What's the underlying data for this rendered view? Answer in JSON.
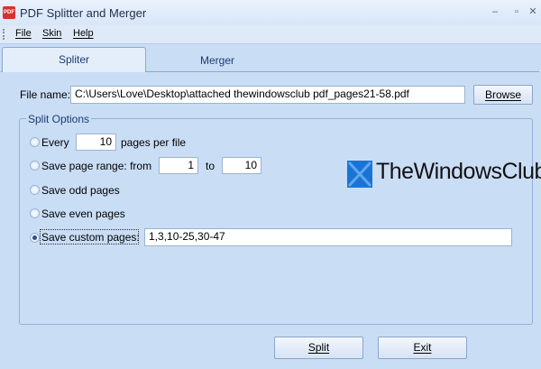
{
  "window": {
    "title": "PDF Splitter and Merger",
    "icon_label": "PDF",
    "minimize_glyph": "–",
    "maximize_glyph": "▫",
    "close_glyph": "✕"
  },
  "menu": {
    "items": [
      "File",
      "Skin",
      "Help"
    ]
  },
  "tabs": [
    {
      "label": "Spliter",
      "active": true
    },
    {
      "label": "Merger",
      "active": false
    }
  ],
  "file": {
    "label": "File name:",
    "value": "C:\\Users\\Love\\Desktop\\attached thewindowsclub pdf_pages21-58.pdf",
    "browse_label": "Browse"
  },
  "split_options": {
    "title": "Split Options",
    "every_label": "Every",
    "every_value": "10",
    "pages_per_file_label": "pages per file",
    "range_label": "Save page range: from",
    "range_from": "1",
    "range_to_label": "to",
    "range_to": "10",
    "odd_label": "Save odd pages",
    "even_label": "Save even pages",
    "custom_label": "Save custom pages:",
    "custom_value": "1,3,10-25,30-47",
    "selected": "custom"
  },
  "actions": {
    "split_label": "Split",
    "exit_label": "Exit"
  },
  "watermark": {
    "text": "TheWindowsClub",
    "logo_color": "#1a74d6"
  }
}
